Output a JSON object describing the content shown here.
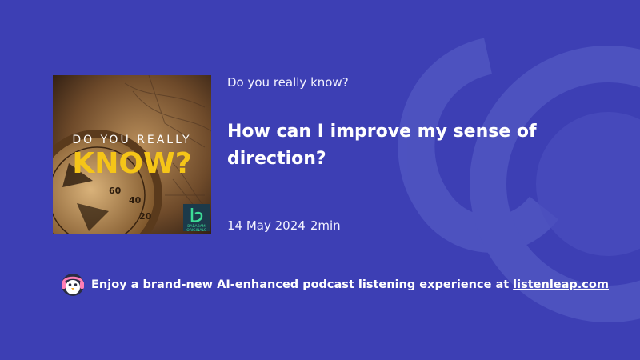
{
  "background": {
    "color": "#3d3fb4"
  },
  "podcast": {
    "show_name": "Do you really know?",
    "cover": {
      "line1": "DO YOU REALLY",
      "line2": "KNOW?",
      "badge_line1": "BABABAM",
      "badge_line2": "ORIGINALS",
      "compass_numbers": [
        "60",
        "40",
        "20"
      ]
    }
  },
  "episode": {
    "title": "How can I improve my sense of direction?",
    "date": "14 May 2024",
    "duration": "2min"
  },
  "promo": {
    "text": "Enjoy a brand-new AI-enhanced podcast listening experience at",
    "link_text": "listenleap.com"
  }
}
